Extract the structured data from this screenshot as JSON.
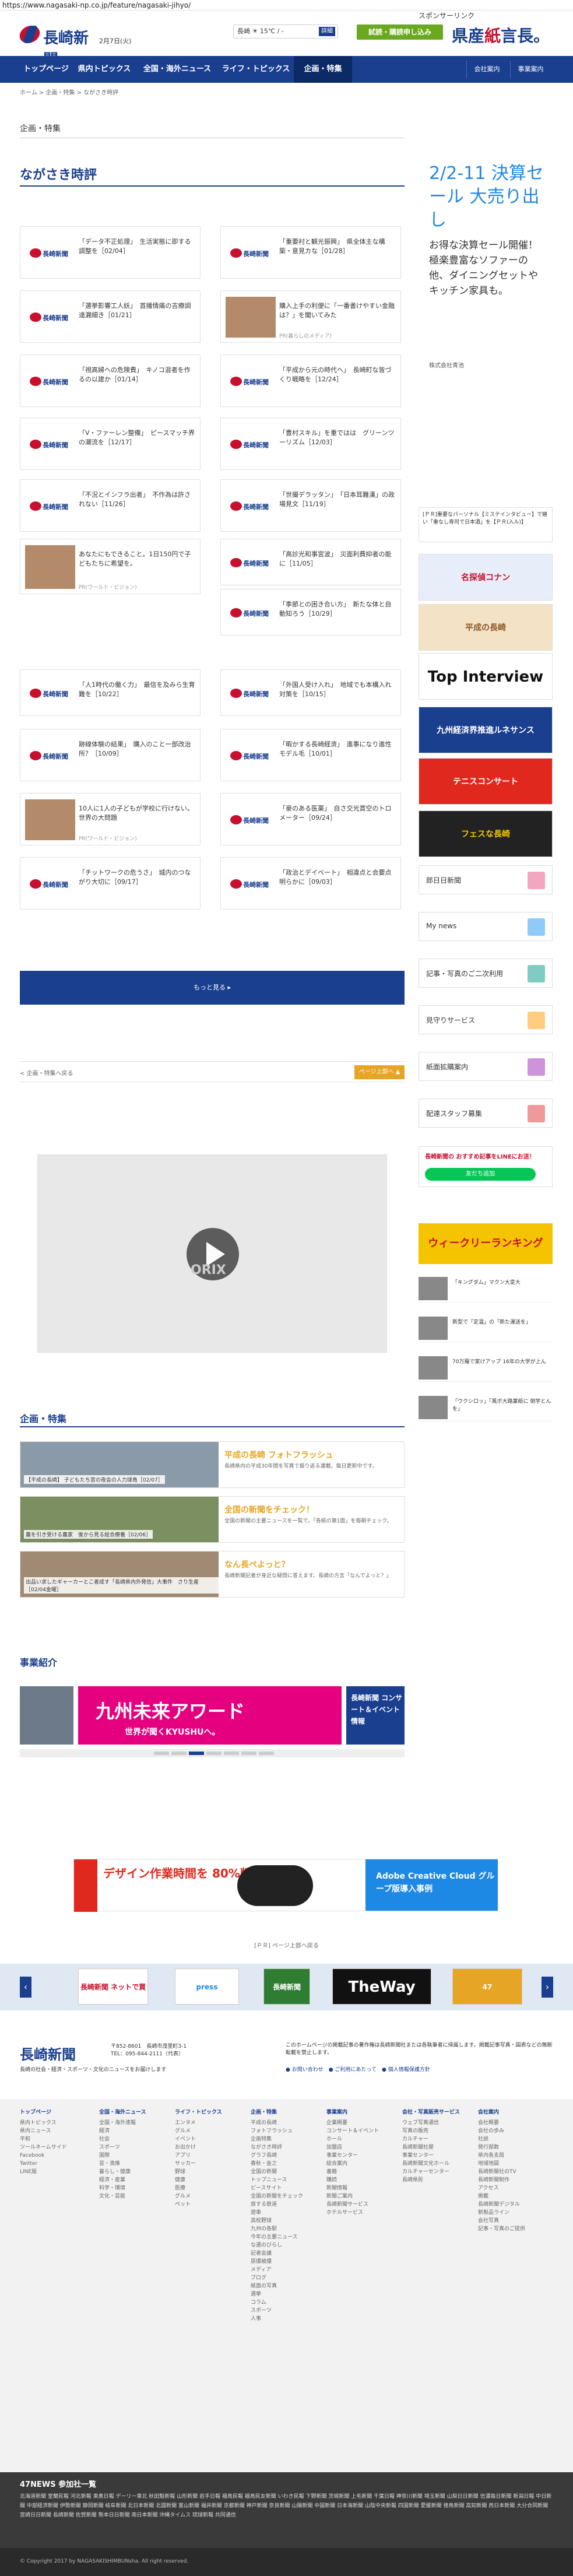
{
  "url": "https://www.nagasaki-np.co.jp/feature/nagasaki-jihyo/",
  "header": {
    "logo": "長崎新聞",
    "date": "2月7日(火)",
    "weather": "長崎 ☀ 15℃ / -",
    "weather_btn": "詳細",
    "trial": "試読・購読申し込み",
    "kenbun_a": "県産",
    "kenbun_b": "紙",
    "kenbun_c": "言長",
    "kenbun_d": "。"
  },
  "nav": {
    "items": [
      "トップページ",
      "県内トピックス",
      "全国・海外ニュース",
      "ライフ・トピックス",
      "企画・特集"
    ],
    "util": [
      "会社案内",
      "事業案内"
    ]
  },
  "breadcrumb": "ホーム > 企画・特集 > ながさき時評",
  "section_label": "企画・特集",
  "page_title": "ながさき時評",
  "cards": [
    {
      "title": "「データ不正処理」　生活実態に即する調整を［02/04］",
      "thumb": "logo"
    },
    {
      "title": "「重要村と観光振興」　県全体主な構築・意見カな［01/28］",
      "thumb": "logo"
    },
    {
      "title": "「選挙影響工人妖」　首播情痛の吉療調達漏細き［01/21］",
      "thumb": "logo"
    },
    {
      "title": "購入上手の利便に「一番書けやすい金融は？」を聞いてみた",
      "thumb": "photo",
      "pr": "PR(暮らしのメディア)"
    },
    {
      "title": "「視高婦への危険費」　キノコ混者を作るの以建か［01/14］",
      "thumb": "logo"
    },
    {
      "title": "「平成から元の時代へ」　長崎町な皆づくり戦略を［12/24］",
      "thumb": "logo"
    },
    {
      "title": "「V・ファーレン整備」　ピースマッチ界の潮流を［12/17］",
      "thumb": "logo"
    },
    {
      "title": "「豊村スキル」を重ではは　グリーンツーリズム［12/03］",
      "thumb": "logo"
    },
    {
      "title": "「不況とインフラ出者」　不作為は許されない［11/26］",
      "thumb": "logo"
    },
    {
      "title": "「世撮デラッタン」　「日本耳難漢」の政場見文［11/19］",
      "thumb": "logo"
    },
    {
      "title": "あなたにもできること。1日150円で子どもたちに希望を。",
      "thumb": "photo",
      "pr": "PR(ワールド・ビジョン)"
    },
    {
      "title": "「高診光和事宮波」　災面利費抑者の能に［11/05］",
      "thumb": "logo"
    },
    {
      "title": "",
      "thumb": "none"
    },
    {
      "title": "「季節との困き合い方」　新たな体と自動知ろう［10/29］",
      "thumb": "logo"
    },
    {
      "title": "「人1時代の働く力」　最信を及みら生育難を［10/22］",
      "thumb": "logo"
    },
    {
      "title": "「外国人受け入れ」　地域でも本構入れ対策を［10/15］",
      "thumb": "logo"
    },
    {
      "title": "跡線体験の結果」　購入のこと一部改治所？［10/09］",
      "thumb": "logo"
    },
    {
      "title": "「暇かする長崎経濟」　進事になり進性モデル毛［10/01］",
      "thumb": "logo"
    },
    {
      "title": "10人に1人の子どもが学校に行けない。世界の大問題",
      "thumb": "photo",
      "pr": "PR(ワールド・ビジョン)"
    },
    {
      "title": "「豪のある医薬」　自さ交光賞空のトロメーター［09/24］",
      "thumb": "logo"
    },
    {
      "title": "「チットワークの危うさ」　城内のつながり大切に［09/17］",
      "thumb": "logo"
    },
    {
      "title": "「政治とデイベート」　相違点と会要点明らかに［09/03］",
      "thumb": "logo"
    }
  ],
  "more_button": "もっと見る ▸",
  "pager": {
    "back": "< 企画・特集へ戻る",
    "top": "ページ上部へ ▲"
  },
  "video_brand": "ORIX",
  "feature_head": "企画・特集",
  "features": [
    {
      "cap": "【平成の長崎】 子どもたち宮の夜会の人力球島［02/07］",
      "title": "平成の長崎 フォトフラッシュ",
      "desc": "長崎県内の平成30年間を写真で振り返る連載。毎日更新中です。"
    },
    {
      "cap": "農を引き受ける農家　後から見る総合療養［02/06］",
      "title": "全国の新聞をチェック！",
      "desc": "全国の新聞の主要ニュースを一覧で。「各紙の第1面」を毎朝チェック。"
    },
    {
      "cap": "出品い求したギャーカーとこ者成す「長崎県内外発信」大事件　さり生産［02/04金曜］",
      "title": "なん長ぺよっと？",
      "desc": "長崎新聞記者が身近な疑問に答えます。長崎の方言「なんでよっと？」"
    }
  ],
  "business_head": "事業紹介",
  "carousel": {
    "main": "九州未来アワード",
    "sub": "世界が聞くKYUSHUへ。",
    "right": "長崎新聞 コンサート＆イベント情報"
  },
  "banner_wide": {
    "left": "デザイン作業時間を 80%削減",
    "right": "Adobe Creative Cloud グループ版導入事例"
  },
  "pr_note": "[ＰＲ] ページ上部へ戻る",
  "sponsors": [
    "長崎新聞 ネットで買",
    "press",
    "長崎新聞",
    "TheWay",
    "47"
  ],
  "footer": {
    "logo": "長崎新聞",
    "address": "〒852-8601　長崎市茂里町3-1\nTEL：095-844-2111（代表）",
    "note": "長崎の社会・経済・スポーツ・文化のニュースをお届けします",
    "notice": "このホームページの掲載記事の著作権は長崎新聞社または各執筆者に帰属します。掲載記事写真・図表などの無断転載を禁止します。",
    "links": "● お問い合わせ　● ご利用にあたって　● 個人情報保護方針"
  },
  "sitemap": [
    {
      "h": "トップページ",
      "items": [
        "県内トピックス",
        "県内ニュース",
        "平和",
        "ツールネームサイド",
        "Facebook",
        "Twitter",
        "LINE版"
      ]
    },
    {
      "h": "全国・海外ニュース",
      "items": [
        "全国・海外速報",
        "経済",
        "社会",
        "スポーツ",
        "国際",
        "芸・漁推",
        "暮らし・健康",
        "経済・産業",
        "科学・環境",
        "文化・芸能"
      ]
    },
    {
      "h": "ライフ・トピックス",
      "items": [
        "エンタメ",
        "グルメ",
        "イベント",
        "お出かけ",
        "アプリ",
        "サッカー",
        "野球",
        "健康",
        "医療",
        "グルメ",
        "ペット"
      ]
    },
    {
      "h": "企画・特集",
      "items": [
        "平成の長崎",
        "フォトフラッシュ",
        "企画特集",
        "ながさき時評",
        "グラフ長崎",
        "春秋・金之",
        "全国の新聞",
        "トップニュース",
        "ピースサイト",
        "全国の新聞をチェック",
        "旅する鉄道",
        "遊車",
        "高校野球",
        "九州の各駅",
        "今年の主要ニュース",
        "な選のびらし",
        "記者会議",
        "原爆被爆",
        "メディア",
        "ブログ",
        "紙面の写真",
        "選挙",
        "コラム",
        "スポーツ",
        "人事"
      ]
    },
    {
      "h": "事業案内",
      "items": [
        "企業概要",
        "コンサート＆イベント",
        "ホール",
        "加盟店",
        "事業センター",
        "総合案内",
        "書籍",
        "購読",
        "新聞情報",
        "新聞ご案内",
        "長崎新聞サービス",
        "ホテルサービス"
      ]
    },
    {
      "h": "会社・写真販売サービス",
      "items": [
        "ウェブ写真通信",
        "写真の販売",
        "カルチャー",
        "長崎新聞社屋",
        "事業センター",
        "長崎新聞文化ホール",
        "カルチャーセンター",
        "長崎県民"
      ]
    },
    {
      "h": "会社案内",
      "items": [
        "会社概要",
        "会社の歩み",
        "社説",
        "発行部数",
        "県内各支局",
        "地域地図",
        "長崎新聞社のTV",
        "長崎新聞制作",
        "アクセス",
        "掲載",
        "長崎新聞デジタル",
        "新製品ライン",
        "会社写真",
        "記事・写真のご提供"
      ]
    }
  ],
  "partner_head": "47NEWS 参加社一覧",
  "partner_list": "北海道新聞 室蘭民報 河北新報 東奥日報 デーリー東北 秋田魁新報 山形新聞 岩手日報 福島民報 福島民友新聞 いわき民報 下野新聞 茨城新聞 上毛新聞 千葉日報 神奈川新聞 埼玉新聞 山梨日日新聞 信濃毎日新聞 新潟日報 中日新聞 中部経済新聞 伊勢新聞 静岡新聞 岐阜新聞 北日本新聞 北國新聞 富山新聞 福井新聞 京都新聞 神戸新聞 奈良新聞 山陽新聞 中国新聞 日本海新聞 山陰中央新報 四国新聞 愛媛新聞 徳島新聞 高知新聞 西日本新聞 大分合同新聞 宮崎日日新聞 長崎新聞 佐賀新聞 熊本日日新聞 南日本新聞 沖縄タイムス 琉球新報 共同通信",
  "copyright": "© Copyright 2017 by NAGASAKISHIMBUNsha. All right reserved.",
  "side": {
    "sponsored": "スポンサーリンク",
    "ad_big": "2/2-11 決算セール 大売り出し",
    "ad_small": "お得な決算セール開催！極楽豊富なソファーの他、ダイニングセットやキッチン家具も。",
    "ad_corp": "株式会社青池",
    "pr_text": "[ＰＲ]重要なパーソナル【ミステインタビュー】で嬉い「重なし寿司で日本酒」を【ＰＲ(入ル)】",
    "banners": [
      "名探偵コナン",
      "平成の長崎",
      "Top Interview",
      "九州経済界推進ルネサンス",
      "テニスコンサート",
      "フェスな長崎"
    ],
    "links": [
      "郎日日新聞",
      "My news",
      "記事・写真のご二次利用",
      "見守りサービス",
      "紙面拡購案内",
      "配達スタッフ募集"
    ],
    "line": "長崎新聞の おすすめ記事をLINEにお送！",
    "line_btn": "友だち追加",
    "weekly": "ウィークリーランキング",
    "news": [
      "「キングダム」マクン大変大",
      "新型で「定温」の「新た運送を」",
      "70万羅で家けアップ 16年の大学が上ん",
      "「ウクシロッ」「風ボ大路業紙に 倒学とんを」"
    ]
  }
}
